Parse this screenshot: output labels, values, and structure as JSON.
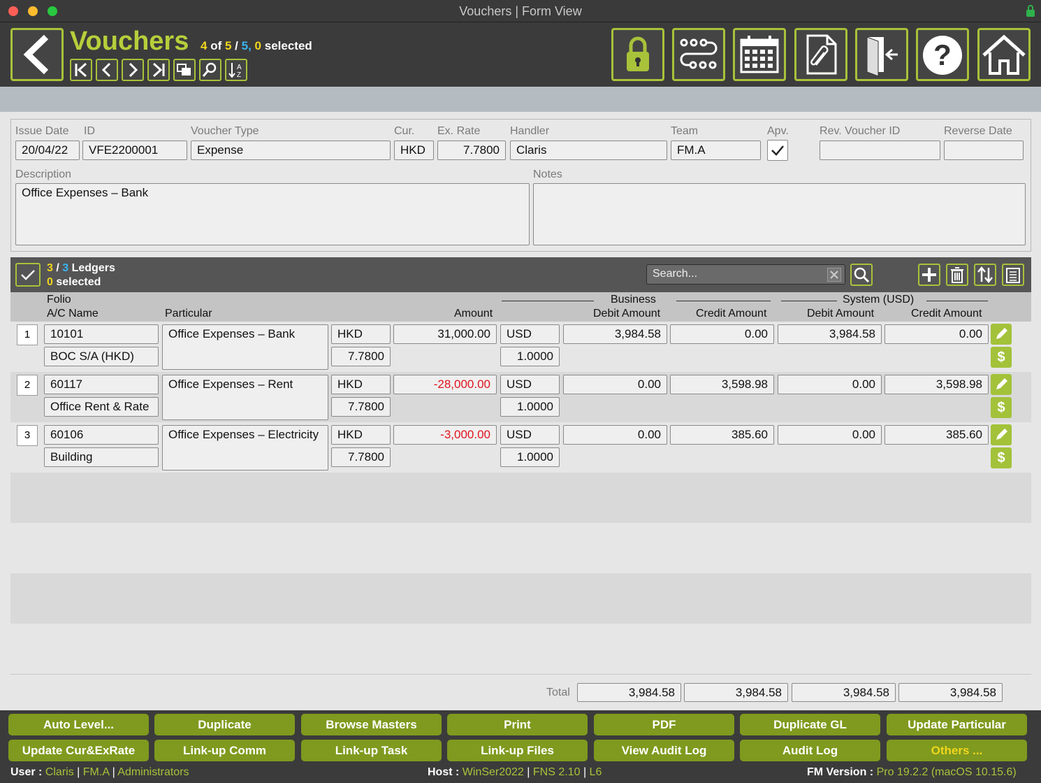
{
  "window": {
    "title": "Vouchers | Form View"
  },
  "header": {
    "title": "Vouchers",
    "record_current": "4",
    "record_of": "of",
    "record_found": "5",
    "record_total": "5,",
    "record_selected": "0",
    "record_selected_label": "selected"
  },
  "form": {
    "labels": {
      "issue_date": "Issue Date",
      "id": "ID",
      "voucher_type": "Voucher Type",
      "cur": "Cur.",
      "ex_rate": "Ex. Rate",
      "handler": "Handler",
      "team": "Team",
      "apv": "Apv.",
      "rev_voucher_id": "Rev. Voucher ID",
      "reverse_date": "Reverse Date",
      "description": "Description",
      "notes": "Notes"
    },
    "issue_date": "20/04/22",
    "id": "VFE2200001",
    "voucher_type": "Expense",
    "cur": "HKD",
    "ex_rate": "7.7800",
    "handler": "Claris",
    "team": "FM.A",
    "apv_checked": true,
    "rev_voucher_id": "",
    "reverse_date": "",
    "description": "Office Expenses – Bank",
    "notes": ""
  },
  "ledgers": {
    "found": "3",
    "total": "3",
    "label": "Ledgers",
    "selected": "0",
    "selected_label": "selected",
    "search_placeholder": "Search..."
  },
  "columns": {
    "folio": "Folio",
    "ac_name": "A/C Name",
    "particular": "Particular",
    "amount": "Amount",
    "business": "Business",
    "system": "System (USD)",
    "debit_amount": "Debit Amount",
    "credit_amount": "Credit Amount"
  },
  "rows": [
    {
      "num": "1",
      "folio": "10101",
      "ac_name": "BOC S/A (HKD)",
      "particular": "Office Expenses – Bank",
      "cur": "HKD",
      "rate": "7.7800",
      "amount": "31,000.00",
      "bcur": "USD",
      "brate": "1.0000",
      "bdebit": "3,984.58",
      "bcredit": "0.00",
      "sdebit": "3,984.58",
      "scredit": "0.00"
    },
    {
      "num": "2",
      "folio": "60117",
      "ac_name": "Office Rent & Rate",
      "particular": "Office Expenses – Rent",
      "cur": "HKD",
      "rate": "7.7800",
      "amount": "-28,000.00",
      "bcur": "USD",
      "brate": "1.0000",
      "bdebit": "0.00",
      "bcredit": "3,598.98",
      "sdebit": "0.00",
      "scredit": "3,598.98"
    },
    {
      "num": "3",
      "folio": "60106",
      "ac_name": "Building",
      "particular": "Office Expenses – Electricity",
      "cur": "HKD",
      "rate": "7.7800",
      "amount": "-3,000.00",
      "bcur": "USD",
      "brate": "1.0000",
      "bdebit": "0.00",
      "bcredit": "385.60",
      "sdebit": "0.00",
      "scredit": "385.60"
    }
  ],
  "totals": {
    "label": "Total",
    "bdebit": "3,984.58",
    "bcredit": "3,984.58",
    "sdebit": "3,984.58",
    "scredit": "3,984.58"
  },
  "buttons": {
    "auto_level": "Auto Level...",
    "duplicate": "Duplicate",
    "browse_masters": "Browse Masters",
    "print": "Print",
    "pdf": "PDF",
    "duplicate_gl": "Duplicate GL",
    "update_particular": "Update Particular",
    "update_cur_exrate": "Update Cur&ExRate",
    "linkup_comm": "Link-up Comm",
    "linkup_task": "Link-up Task",
    "linkup_files": "Link-up Files",
    "view_audit_log": "View Audit Log",
    "audit_log": "Audit Log",
    "others": "Others ..."
  },
  "status": {
    "user_label": "User :",
    "user": "Claris",
    "team": "FM.A",
    "group": "Administrators",
    "host_label": "Host :",
    "host": "WinSer2022",
    "fns": "FNS 2.10",
    "level": "L6",
    "fm_label": "FM Version :",
    "fm_version": "Pro 19.2.2 (macOS 10.15.6)",
    "sep": "|"
  },
  "colors": {
    "accent": "#a8c23a",
    "button": "#7f9a1e",
    "negative": "#e0141e",
    "highlight_yellow": "#f1d61e",
    "highlight_cyan": "#3ab4f2"
  }
}
